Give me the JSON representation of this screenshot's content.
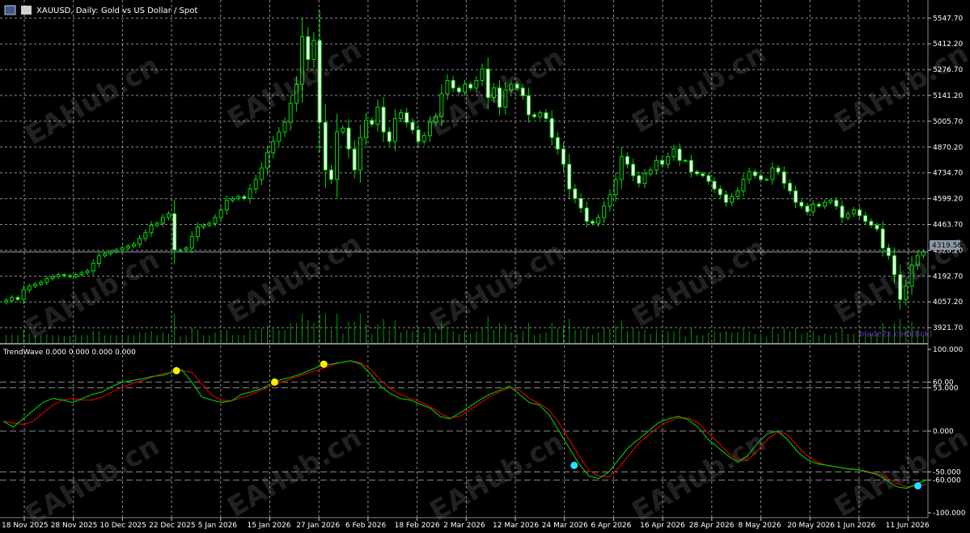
{
  "header": {
    "symbol": "XAUUSD",
    "timeframe": "Daily",
    "description": "Gold vs US Dollar / Spot",
    "title_text": "XAUUSD, Daily:  Gold vs US Dollar / Spot"
  },
  "price_panel": {
    "current_price_label": "4319.56",
    "current_price": 4319.56,
    "watermark_site": "EAHub.cn",
    "source_label": "blade2x.com(tick)"
  },
  "indicator": {
    "label": "TrendWave 0.000 0.000 0.000 0.000",
    "level_labels": [
      "100.000",
      "60.00",
      "53.000",
      "0.000",
      "-50.000",
      "-60.000",
      "-100.000"
    ]
  },
  "colors": {
    "background": "#000000",
    "grid": "#8c8c8c",
    "candle": "#00e000",
    "wave_fast": "#00c000",
    "wave_slow": "#d00000",
    "top_signal": "#ffee00",
    "bottom_signal": "#22e0ff",
    "axis_text": "#ffffff"
  },
  "chart_data": [
    {
      "type": "candlestick",
      "title": "XAUUSD, Daily:  Gold vs US Dollar / Spot",
      "ylim": [
        3850,
        5600
      ],
      "y_ticks": [
        "5547.70",
        "5412.20",
        "5276.70",
        "5141.20",
        "5005.70",
        "4870.20",
        "4734.70",
        "4599.20",
        "4463.70",
        "4328.20",
        "4192.70",
        "4057.20",
        "3921.70"
      ],
      "x_ticks": [
        "18 Nov 2025",
        "28 Nov 2025",
        "10 Dec 2025",
        "22 Dec 2025",
        "5 Jan 2026",
        "15 Jan 2026",
        "27 Jan 2026",
        "6 Feb 2026",
        "18 Feb 2026",
        "2 Mar 2026",
        "12 Mar 2026",
        "24 Mar 2026",
        "6 Apr 2026",
        "16 Apr 2026",
        "28 Apr 2026",
        "8 May 2026",
        "20 May 2026",
        "1 Jun 2026",
        "11 Jun 2026"
      ],
      "grid": true,
      "last_price": 4319.56,
      "close": [
        4065,
        4080,
        4070,
        4120,
        4140,
        4150,
        4160,
        4180,
        4190,
        4200,
        4195,
        4190,
        4200,
        4210,
        4220,
        4260,
        4300,
        4310,
        4320,
        4330,
        4340,
        4350,
        4360,
        4390,
        4420,
        4460,
        4470,
        4500,
        4520,
        4330,
        4330,
        4340,
        4400,
        4450,
        4460,
        4470,
        4500,
        4540,
        4590,
        4600,
        4610,
        4600,
        4650,
        4700,
        4760,
        4840,
        4900,
        4950,
        5000,
        5100,
        5200,
        5450,
        5330,
        5430,
        5000,
        4750,
        4700,
        4950,
        4970,
        4860,
        4750,
        4920,
        5010,
        4990,
        5080,
        4950,
        4900,
        5020,
        5050,
        5000,
        4960,
        4900,
        4930,
        5000,
        5030,
        5150,
        5220,
        5180,
        5160,
        5200,
        5180,
        5220,
        5280,
        5130,
        5180,
        5080,
        5170,
        5200,
        5180,
        5140,
        5040,
        5030,
        5050,
        5020,
        4920,
        4860,
        4780,
        4650,
        4600,
        4550,
        4480,
        4470,
        4500,
        4560,
        4620,
        4700,
        4820,
        4780,
        4720,
        4680,
        4730,
        4750,
        4800,
        4780,
        4820,
        4860,
        4800,
        4800,
        4740,
        4730,
        4720,
        4690,
        4650,
        4620,
        4580,
        4610,
        4640,
        4700,
        4740,
        4720,
        4700,
        4700,
        4760,
        4740,
        4680,
        4640,
        4580,
        4560,
        4530,
        4570,
        4560,
        4580,
        4590,
        4560,
        4500,
        4520,
        4540,
        4510,
        4480,
        4460,
        4440,
        4340,
        4300,
        4200,
        4070,
        4140,
        4250,
        4300,
        4320
      ],
      "volume_ticks_high_around": "27 Jan 2026",
      "indicator": {
        "name": "TrendWave",
        "ylim": [
          -100,
          100
        ],
        "levels": [
          100,
          60,
          53,
          0,
          -50,
          -60,
          -100
        ],
        "series": [
          {
            "name": "",
            "color": "#00c000",
            "values": [
              12,
              5,
              15,
              25,
              35,
              40,
              38,
              35,
              40,
              45,
              48,
              55,
              60,
              62,
              64,
              67,
              68,
              72,
              75,
              60,
              42,
              38,
              35,
              37,
              45,
              48,
              52,
              58,
              63,
              66,
              70,
              75,
              80,
              82,
              84,
              86,
              82,
              70,
              55,
              46,
              40,
              38,
              33,
              28,
              18,
              15,
              22,
              30,
              38,
              45,
              50,
              55,
              45,
              35,
              32,
              20,
              0,
              -20,
              -40,
              -55,
              -58,
              -50,
              -35,
              -20,
              -10,
              0,
              10,
              15,
              18,
              14,
              5,
              -10,
              -20,
              -30,
              -38,
              -30,
              -15,
              -3,
              0,
              -10,
              -25,
              -35,
              -40,
              -42,
              -44,
              -46,
              -47,
              -50,
              -53,
              -60,
              -68,
              -70,
              -65,
              -60
            ]
          },
          {
            "name": "",
            "color": "#d00000",
            "values": [
              12,
              10,
              8,
              12,
              22,
              32,
              38,
              40,
              38,
              38,
              42,
              48,
              54,
              58,
              62,
              66,
              70,
              72,
              74,
              72,
              58,
              44,
              38,
              37,
              41,
              45,
              50,
              55,
              60,
              64,
              68,
              72,
              76,
              80,
              84,
              86,
              84,
              76,
              63,
              52,
              45,
              40,
              36,
              30,
              22,
              16,
              18,
              26,
              34,
              42,
              48,
              53,
              50,
              40,
              34,
              26,
              10,
              -10,
              -30,
              -48,
              -55,
              -56,
              -45,
              -30,
              -15,
              -5,
              5,
              12,
              16,
              16,
              10,
              -2,
              -14,
              -26,
              -35,
              -36,
              -24,
              -10,
              -1,
              -4,
              -18,
              -30,
              -38,
              -42,
              -44,
              -46,
              -47,
              -49,
              -52,
              -57,
              -64,
              -68,
              -68,
              -65
            ]
          }
        ],
        "top_signals_at": [
          "22 Dec 2025",
          "15 Jan 2026",
          "27 Jan 2026"
        ],
        "bottom_signals_at": [
          "24 Mar 2026",
          "11 Jun 2026"
        ]
      }
    }
  ]
}
